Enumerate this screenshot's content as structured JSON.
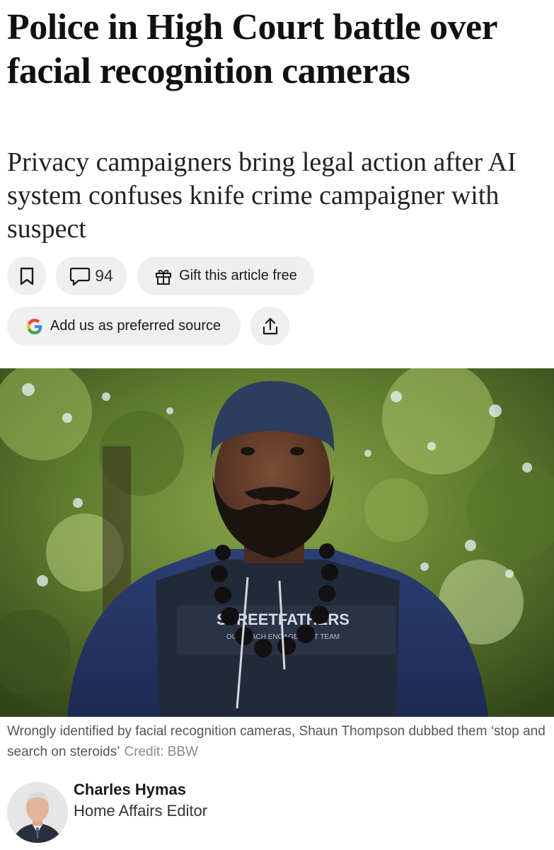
{
  "article": {
    "headline": "Police in High Court battle over facial recognition cameras",
    "standfirst": "Privacy campaigners bring legal action after AI system confuses knife crime campaigner with suspect"
  },
  "actions": {
    "bookmark_icon": "bookmark-icon",
    "comment_icon": "comment-icon",
    "comment_count": "94",
    "gift_icon": "gift-icon",
    "gift_label": "Gift this article free",
    "google_icon": "google-g-icon",
    "preferred_source_label": "Add us as preferred source",
    "share_icon": "share-icon"
  },
  "photo": {
    "caption": "Wrongly identified by facial recognition cameras, Shaun Thompson dubbed them ‘stop and search on steroids’",
    "credit": "Credit: BBW",
    "vest_text": "STREETFATHERS",
    "vest_subtext": "OUTREACH ENGAGEMENT TEAM"
  },
  "author": {
    "name": "Charles Hymas",
    "role": "Home Affairs Editor"
  },
  "colors": {
    "pill_bg": "#efefef",
    "caption_text": "#555555",
    "credit_text": "#8a8a8a",
    "google_blue": "#4285F4",
    "google_red": "#EA4335",
    "google_yellow": "#FBBC05",
    "google_green": "#34A853"
  }
}
